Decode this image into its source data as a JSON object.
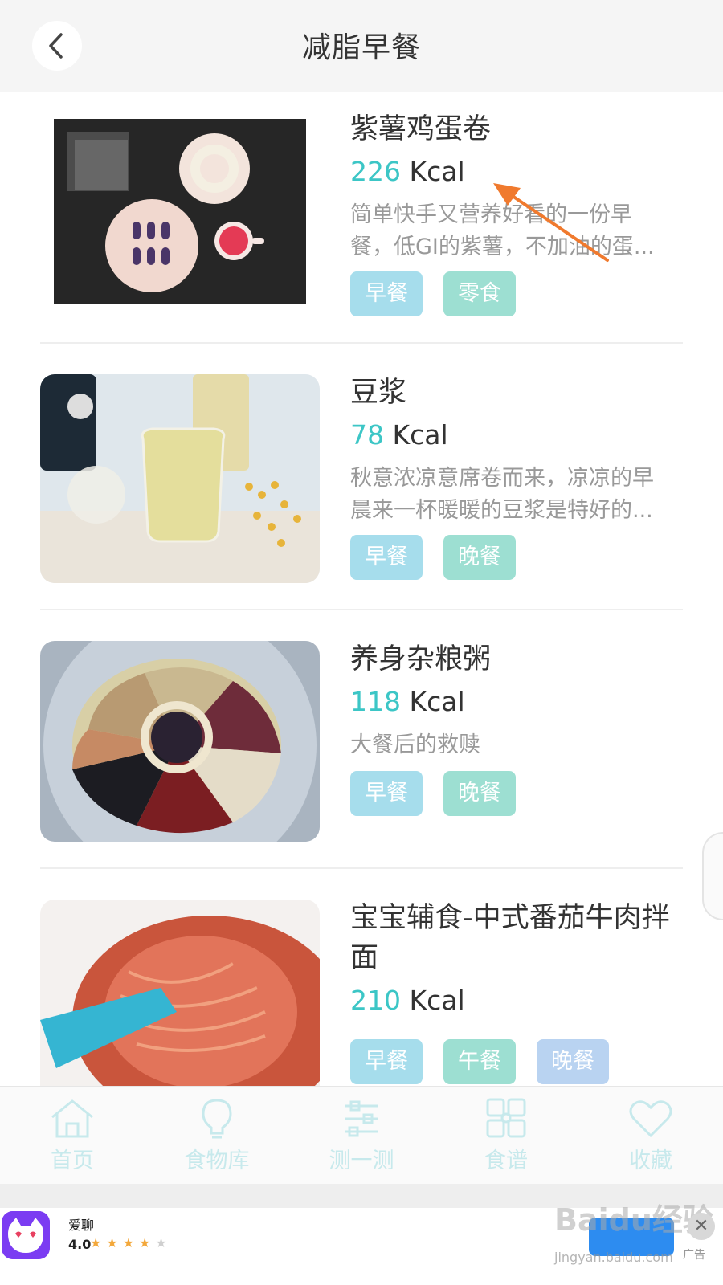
{
  "header": {
    "title": "减脂早餐",
    "back_icon": "chevron-left-icon"
  },
  "foods": [
    {
      "name": "紫薯鸡蛋卷",
      "kcal_value": "226",
      "kcal_unit": " Kcal",
      "desc_lines": [
        "简单快手又营养好看的一份早",
        "餐，低GI的紫薯，不加油的蛋..."
      ],
      "tags": [
        "早餐",
        "零食"
      ]
    },
    {
      "name": "豆浆",
      "kcal_value": "78",
      "kcal_unit": " Kcal",
      "desc_lines": [
        "秋意浓凉意席卷而来，凉凉的早",
        "晨来一杯暖暖的豆浆是特好的..."
      ],
      "tags": [
        "早餐",
        "晚餐"
      ]
    },
    {
      "name": "养身杂粮粥",
      "kcal_value": "118",
      "kcal_unit": " Kcal",
      "desc_lines": [
        "大餐后的救赎"
      ],
      "tags": [
        "早餐",
        "晚餐"
      ]
    },
    {
      "name": "宝宝辅食-中式番茄牛肉拌面",
      "kcal_value": "210",
      "kcal_unit": " Kcal",
      "desc_lines": [],
      "tags": [
        "早餐",
        "午餐",
        "晚餐"
      ]
    }
  ],
  "bottom_nav": [
    {
      "label": "首页",
      "icon": "home-icon"
    },
    {
      "label": "食物库",
      "icon": "lightbulb-icon"
    },
    {
      "label": "测一测",
      "icon": "sliders-icon"
    },
    {
      "label": "食谱",
      "icon": "grid-icon"
    },
    {
      "label": "收藏",
      "icon": "heart-icon"
    }
  ],
  "ad": {
    "app_name": "爱聊",
    "rating": "4.0",
    "label": "广告",
    "watermark": "Baidu经验",
    "watermark_sub": "jingyan.baidu.com"
  },
  "colors": {
    "kcal_accent": "#3cc6c6",
    "tag_blue": "#a6ddec",
    "tag_green": "#9ddfd2",
    "tag_lavender": "#b9d3f1",
    "annotation_arrow": "#f07a2e"
  }
}
